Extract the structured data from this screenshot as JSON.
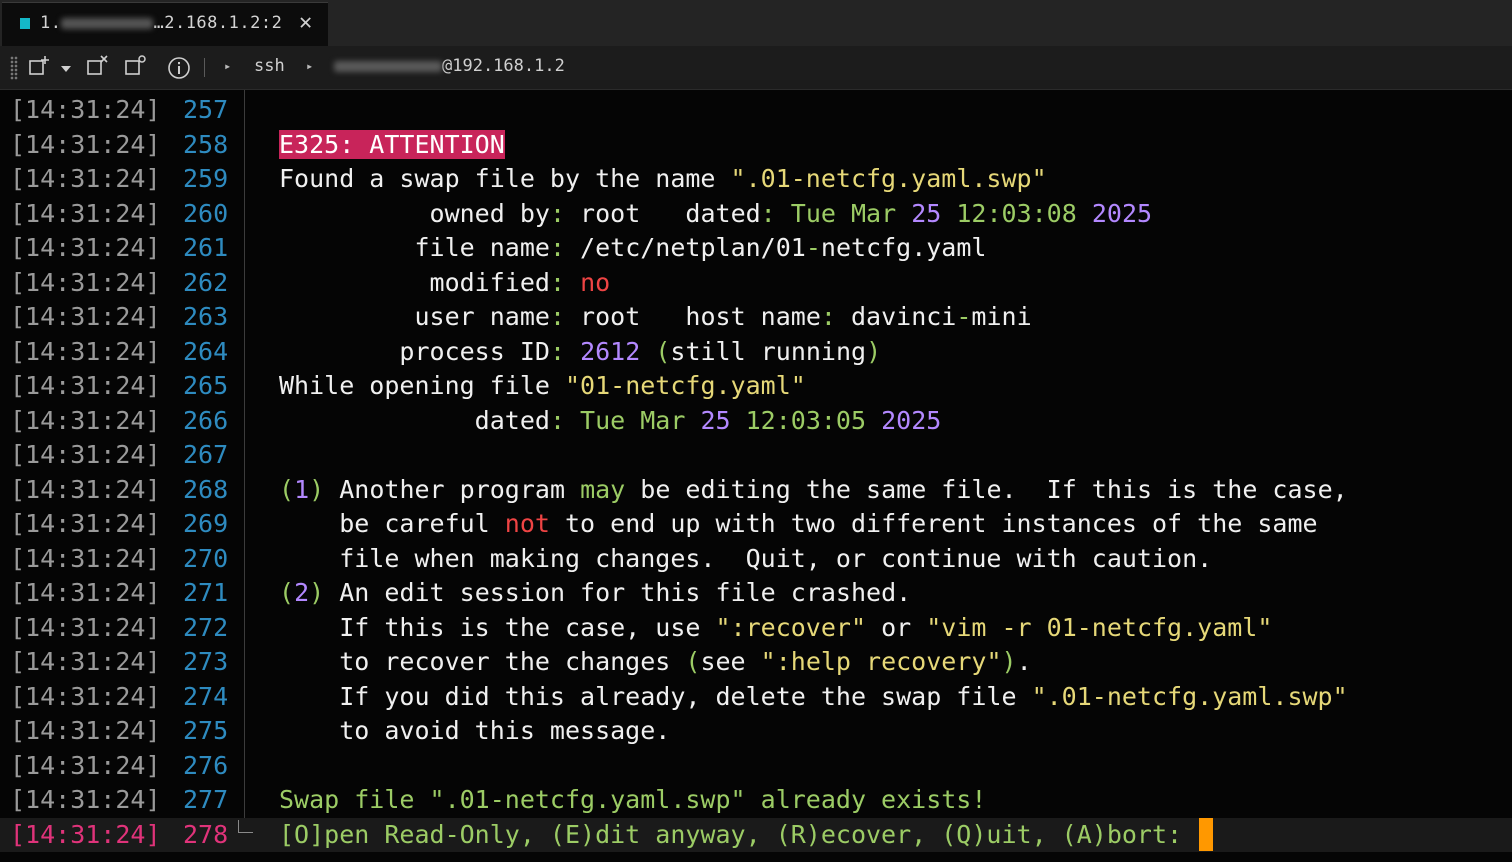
{
  "tab": {
    "title_prefix": "1.",
    "title_suffix": "…2.168.1.2:2",
    "close": "✕"
  },
  "toolbar": {
    "crumbs": [
      "ssh",
      "@192.168.1.2"
    ]
  },
  "colors": {
    "timestamp": "#9a9a9a",
    "line_number": "#2e8bc0",
    "current_line": "#e0337a",
    "attention_bg": "#c8245a",
    "yellow": "#e6d878",
    "green": "#9ccc65",
    "purple": "#b388ff",
    "red": "#ef4444",
    "cursor": "#ff9800",
    "tab_indicator": "#14b8c8"
  },
  "lines": [
    {
      "ts": "[14:31:24]",
      "n": "257",
      "segs": []
    },
    {
      "ts": "[14:31:24]",
      "n": "258",
      "segs": [
        {
          "t": "E325: ATTENTION",
          "c": "attn"
        }
      ]
    },
    {
      "ts": "[14:31:24]",
      "n": "259",
      "segs": [
        {
          "t": "Found a swap file by the name ",
          "c": "w"
        },
        {
          "t": "\".01-netcfg.yaml.swp\"",
          "c": "y"
        }
      ]
    },
    {
      "ts": "[14:31:24]",
      "n": "260",
      "segs": [
        {
          "t": "          owned by",
          "c": "w"
        },
        {
          "t": ":",
          "c": "g"
        },
        {
          "t": " root   dated",
          "c": "w"
        },
        {
          "t": ": Tue Mar ",
          "c": "g"
        },
        {
          "t": "25",
          "c": "p"
        },
        {
          "t": " ",
          "c": "w"
        },
        {
          "t": "12:03:08",
          "c": "g"
        },
        {
          "t": " ",
          "c": "w"
        },
        {
          "t": "2025",
          "c": "p"
        }
      ]
    },
    {
      "ts": "[14:31:24]",
      "n": "261",
      "segs": [
        {
          "t": "         file name",
          "c": "w"
        },
        {
          "t": ":",
          "c": "g"
        },
        {
          "t": " /etc/netplan/01",
          "c": "w"
        },
        {
          "t": "-",
          "c": "g"
        },
        {
          "t": "netcfg.yaml",
          "c": "w"
        }
      ]
    },
    {
      "ts": "[14:31:24]",
      "n": "262",
      "segs": [
        {
          "t": "          modified",
          "c": "w"
        },
        {
          "t": ":",
          "c": "g"
        },
        {
          "t": " ",
          "c": "w"
        },
        {
          "t": "no",
          "c": "r"
        }
      ]
    },
    {
      "ts": "[14:31:24]",
      "n": "263",
      "segs": [
        {
          "t": "         user name",
          "c": "w"
        },
        {
          "t": ":",
          "c": "g"
        },
        {
          "t": " root   host name",
          "c": "w"
        },
        {
          "t": ":",
          "c": "g"
        },
        {
          "t": " davinci",
          "c": "w"
        },
        {
          "t": "-",
          "c": "g"
        },
        {
          "t": "mini",
          "c": "w"
        }
      ]
    },
    {
      "ts": "[14:31:24]",
      "n": "264",
      "segs": [
        {
          "t": "        process ID",
          "c": "w"
        },
        {
          "t": ":",
          "c": "g"
        },
        {
          "t": " ",
          "c": "w"
        },
        {
          "t": "2612",
          "c": "p"
        },
        {
          "t": " ",
          "c": "w"
        },
        {
          "t": "(",
          "c": "g"
        },
        {
          "t": "still running",
          "c": "w"
        },
        {
          "t": ")",
          "c": "g"
        }
      ]
    },
    {
      "ts": "[14:31:24]",
      "n": "265",
      "segs": [
        {
          "t": "While opening file ",
          "c": "w"
        },
        {
          "t": "\"01-netcfg.yaml\"",
          "c": "y"
        }
      ]
    },
    {
      "ts": "[14:31:24]",
      "n": "266",
      "segs": [
        {
          "t": "             dated",
          "c": "w"
        },
        {
          "t": ": Tue Mar ",
          "c": "g"
        },
        {
          "t": "25",
          "c": "p"
        },
        {
          "t": " ",
          "c": "w"
        },
        {
          "t": "12:03:05",
          "c": "g"
        },
        {
          "t": " ",
          "c": "w"
        },
        {
          "t": "2025",
          "c": "p"
        }
      ]
    },
    {
      "ts": "[14:31:24]",
      "n": "267",
      "segs": []
    },
    {
      "ts": "[14:31:24]",
      "n": "268",
      "segs": [
        {
          "t": "(",
          "c": "g"
        },
        {
          "t": "1",
          "c": "p"
        },
        {
          "t": ")",
          "c": "g"
        },
        {
          "t": " Another program ",
          "c": "w"
        },
        {
          "t": "may",
          "c": "g"
        },
        {
          "t": " be editing the same file.  If this is the case,",
          "c": "w"
        }
      ]
    },
    {
      "ts": "[14:31:24]",
      "n": "269",
      "segs": [
        {
          "t": "    be careful ",
          "c": "w"
        },
        {
          "t": "not",
          "c": "r"
        },
        {
          "t": " to end up with two different instances of the same",
          "c": "w"
        }
      ]
    },
    {
      "ts": "[14:31:24]",
      "n": "270",
      "segs": [
        {
          "t": "    file when making changes.  Quit, or continue with caution.",
          "c": "w"
        }
      ]
    },
    {
      "ts": "[14:31:24]",
      "n": "271",
      "segs": [
        {
          "t": "(",
          "c": "g"
        },
        {
          "t": "2",
          "c": "p"
        },
        {
          "t": ")",
          "c": "g"
        },
        {
          "t": " An edit session for this file crashed.",
          "c": "w"
        }
      ]
    },
    {
      "ts": "[14:31:24]",
      "n": "272",
      "segs": [
        {
          "t": "    If this is the case, use ",
          "c": "w"
        },
        {
          "t": "\":recover\"",
          "c": "y"
        },
        {
          "t": " or ",
          "c": "w"
        },
        {
          "t": "\"vim -r 01-netcfg.yaml\"",
          "c": "y"
        }
      ]
    },
    {
      "ts": "[14:31:24]",
      "n": "273",
      "segs": [
        {
          "t": "    to recover the changes ",
          "c": "w"
        },
        {
          "t": "(",
          "c": "g"
        },
        {
          "t": "see ",
          "c": "w"
        },
        {
          "t": "\":help recovery\"",
          "c": "y"
        },
        {
          "t": ")",
          "c": "g"
        },
        {
          "t": ".",
          "c": "w"
        }
      ]
    },
    {
      "ts": "[14:31:24]",
      "n": "274",
      "segs": [
        {
          "t": "    If you did this already, delete the swap file ",
          "c": "w"
        },
        {
          "t": "\".01-netcfg.yaml.swp\"",
          "c": "y"
        }
      ]
    },
    {
      "ts": "[14:31:24]",
      "n": "275",
      "segs": [
        {
          "t": "    to avoid this message.",
          "c": "w"
        }
      ]
    },
    {
      "ts": "[14:31:24]",
      "n": "276",
      "segs": []
    },
    {
      "ts": "[14:31:24]",
      "n": "277",
      "segs": [
        {
          "t": "Swap file \".01-netcfg.yaml.swp\" already exists!",
          "c": "g"
        }
      ]
    },
    {
      "ts": "[14:31:24]",
      "n": "278",
      "segs": [
        {
          "t": "[O]pen Read-Only, (E)dit anyway, (R)ecover, (Q)uit, (A)bort: ",
          "c": "g"
        }
      ],
      "current": true
    }
  ]
}
